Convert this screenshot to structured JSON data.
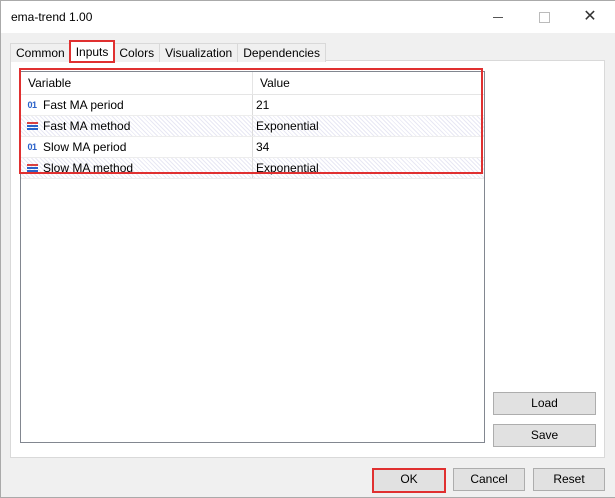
{
  "window": {
    "title": "ema-trend 1.00"
  },
  "tabs": [
    {
      "label": "Common"
    },
    {
      "label": "Inputs"
    },
    {
      "label": "Colors"
    },
    {
      "label": "Visualization"
    },
    {
      "label": "Dependencies"
    }
  ],
  "active_tab": "Inputs",
  "grid": {
    "columns": {
      "variable": "Variable",
      "value": "Value"
    },
    "rows": [
      {
        "icon": "integer-icon",
        "variable": "Fast MA period",
        "value": "21"
      },
      {
        "icon": "enum-list-icon",
        "variable": "Fast MA method",
        "value": "Exponential"
      },
      {
        "icon": "integer-icon",
        "variable": "Slow MA period",
        "value": "34"
      },
      {
        "icon": "enum-list-icon",
        "variable": "Slow MA method",
        "value": "Exponential"
      }
    ]
  },
  "icons": {
    "integer_glyph": "01"
  },
  "buttons": {
    "load": "Load",
    "save": "Save",
    "ok": "OK",
    "cancel": "Cancel",
    "reset": "Reset"
  },
  "colors": {
    "highlight": "#e03030",
    "icon_blue": "#2a62c9",
    "icon_red": "#d94040"
  }
}
